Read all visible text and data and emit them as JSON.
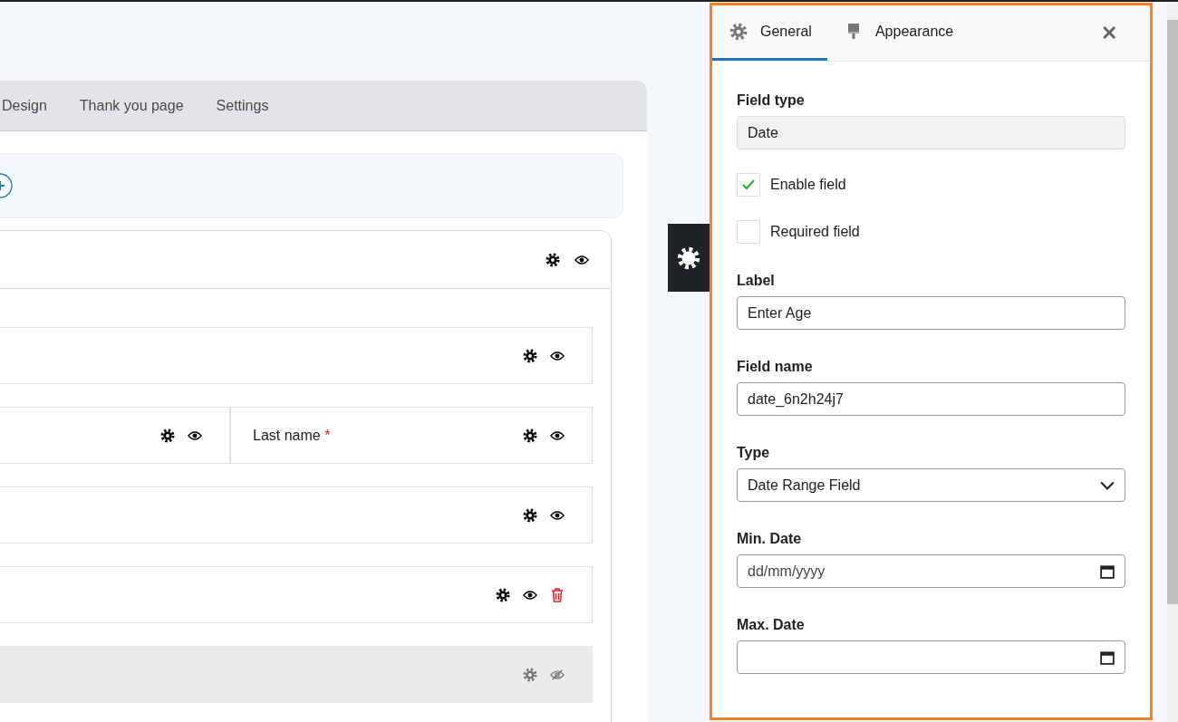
{
  "builder_tabs": [
    {
      "label": "Design",
      "selected": false
    },
    {
      "label": "Thank you page",
      "selected": false
    },
    {
      "label": "Settings",
      "selected": false
    }
  ],
  "section": {
    "has_delete": false
  },
  "rows": [
    {
      "hidden": false,
      "cells": [
        {
          "has_delete": false
        }
      ]
    },
    {
      "hidden": false,
      "cells": [
        {
          "has_delete": false
        },
        {
          "label": "Last name",
          "required_mark": "*",
          "has_delete": false
        }
      ]
    },
    {
      "hidden": false,
      "cells": [
        {
          "has_delete": false
        }
      ]
    },
    {
      "hidden": false,
      "cells": [
        {
          "has_delete": true
        }
      ]
    },
    {
      "hidden": true,
      "cells": [
        {
          "has_delete": false
        }
      ]
    }
  ],
  "panel": {
    "tabs": [
      {
        "label": "General",
        "selected": true
      },
      {
        "label": "Appearance",
        "selected": false
      }
    ],
    "close": "✕",
    "fields": [
      {
        "kind": "readonly",
        "label": "Field type",
        "value": "Date"
      },
      {
        "kind": "checkbox",
        "label": "Enable field",
        "checked": true
      },
      {
        "kind": "checkbox",
        "label": "Required field",
        "checked": false
      },
      {
        "kind": "text",
        "label": "Label",
        "value": "Enter Age"
      },
      {
        "kind": "text",
        "label": "Field name",
        "value": "date_6n2h24j7"
      },
      {
        "kind": "select",
        "label": "Type",
        "value": "Date Range Field"
      },
      {
        "kind": "date",
        "label": "Min. Date",
        "placeholder": "dd/mm/yyyy"
      },
      {
        "kind": "date",
        "label": "Max. Date"
      }
    ]
  }
}
